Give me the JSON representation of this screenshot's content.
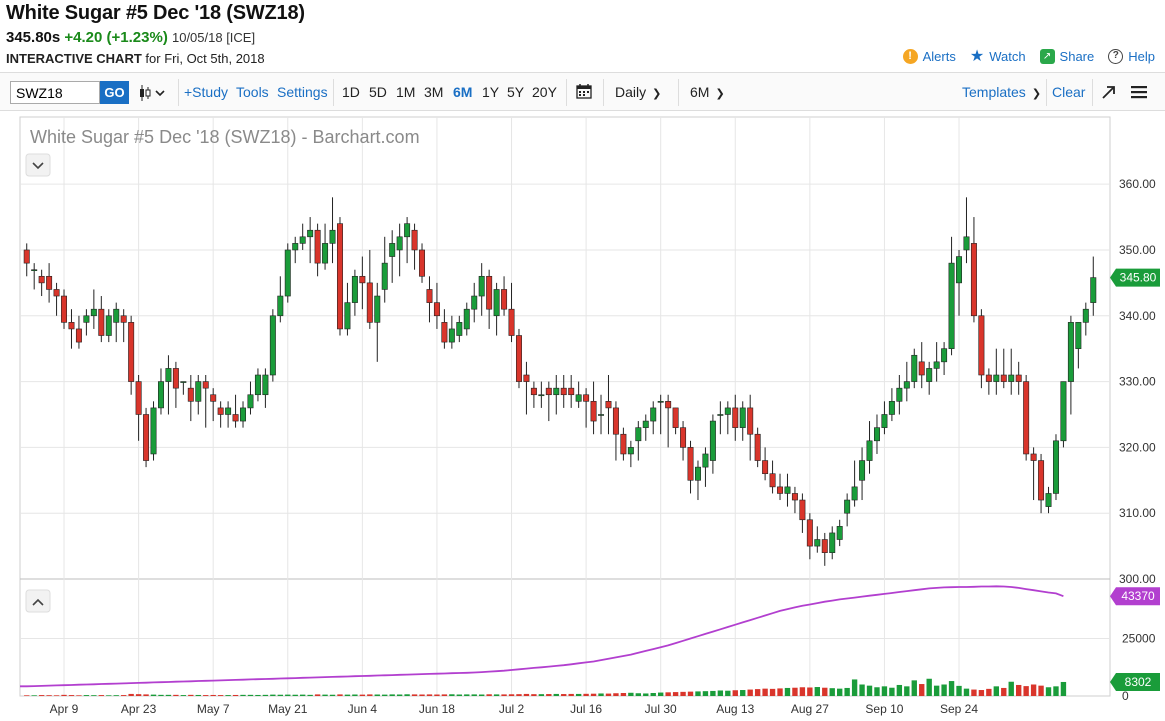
{
  "header": {
    "title": "White Sugar #5 Dec '18 (SWZ18)",
    "last_price": "345.80s",
    "change": "+4.20 (+1.23%)",
    "date_exchange": "10/05/18 [ICE]",
    "subtitle_bold": "INTERACTIVE CHART",
    "subtitle_rest": "for Fri, Oct 5th, 2018"
  },
  "actions": {
    "alerts": "Alerts",
    "watch": "Watch",
    "share": "Share",
    "help": "Help",
    "icons": [
      "exclamation-icon",
      "star-icon",
      "share-icon",
      "question-icon"
    ]
  },
  "toolbar": {
    "symbol_value": "SWZ18",
    "go_label": "GO",
    "study_label": "+Study",
    "tools_label": "Tools",
    "settings_label": "Settings",
    "periods": [
      "1D",
      "5D",
      "1M",
      "3M",
      "6M",
      "1Y",
      "5Y",
      "20Y"
    ],
    "active_period": "6M",
    "interval": "Daily",
    "range": "6M",
    "templates_label": "Templates",
    "clear_label": "Clear"
  },
  "colors": {
    "up": "#1a9c3a",
    "down": "#d9352b",
    "volume_line": "#b23fcf",
    "accent": "#1a6fc4",
    "price_badge": "#1a9c3a"
  },
  "chart_data": {
    "type": "candlestick",
    "title": "White Sugar #5 Dec '18 (SWZ18) - Barchart.com",
    "price_ylim": [
      300,
      362
    ],
    "price_ticks": [
      "360.00",
      "350.00",
      "340.00",
      "330.00",
      "320.00",
      "310.00",
      "300.00"
    ],
    "last_price_label": "345.80",
    "volume_ticks": [
      "25000",
      "0"
    ],
    "open_interest_label": "43370",
    "volume_label": "8302",
    "x_labels": [
      "Apr 9",
      "Apr 23",
      "May 7",
      "May 21",
      "Jun 4",
      "Jun 18",
      "Jul 2",
      "Jul 16",
      "Jul 30",
      "Aug 13",
      "Aug 27",
      "Sep 10",
      "Sep 24"
    ],
    "candles": [
      [
        350,
        351,
        346,
        348
      ],
      [
        347,
        348,
        344,
        347
      ],
      [
        346,
        347,
        343,
        345
      ],
      [
        346,
        348,
        342,
        344
      ],
      [
        344,
        345,
        340,
        343
      ],
      [
        343,
        344,
        338,
        339
      ],
      [
        339,
        341,
        335,
        338
      ],
      [
        338,
        340,
        335,
        336
      ],
      [
        339,
        341,
        337,
        340
      ],
      [
        340,
        344,
        338,
        341
      ],
      [
        341,
        343,
        336,
        337
      ],
      [
        337,
        341,
        336,
        340
      ],
      [
        339,
        342,
        336,
        341
      ],
      [
        340,
        341,
        336,
        339
      ],
      [
        339,
        340,
        328,
        330
      ],
      [
        330,
        331,
        321,
        325
      ],
      [
        325,
        326,
        317,
        318
      ],
      [
        319,
        327,
        318,
        326
      ],
      [
        326,
        332,
        325,
        330
      ],
      [
        330,
        334,
        325,
        332
      ],
      [
        332,
        333,
        326,
        329
      ],
      [
        330,
        330,
        328,
        330
      ],
      [
        329,
        331,
        324,
        327
      ],
      [
        327,
        331,
        325,
        330
      ],
      [
        330,
        331,
        323,
        329
      ],
      [
        328,
        329,
        324,
        327
      ],
      [
        326,
        327,
        323,
        325
      ],
      [
        325,
        327,
        323,
        326
      ],
      [
        325,
        328,
        323,
        324
      ],
      [
        324,
        327,
        323,
        326
      ],
      [
        326,
        330,
        325,
        328
      ],
      [
        328,
        332,
        327,
        331
      ],
      [
        328,
        332,
        326,
        331
      ],
      [
        331,
        341,
        330,
        340
      ],
      [
        340,
        346,
        339,
        343
      ],
      [
        343,
        351,
        342,
        350
      ],
      [
        350,
        352,
        348,
        351
      ],
      [
        351,
        354,
        350,
        352
      ],
      [
        352,
        355,
        348,
        353
      ],
      [
        353,
        354,
        346,
        348
      ],
      [
        348,
        354,
        347,
        351
      ],
      [
        351,
        358,
        348,
        353
      ],
      [
        354,
        355,
        337,
        338
      ],
      [
        338,
        345,
        337,
        342
      ],
      [
        342,
        347,
        340,
        346
      ],
      [
        346,
        349,
        341,
        345
      ],
      [
        345,
        350,
        338,
        339
      ],
      [
        339,
        345,
        333,
        343
      ],
      [
        344,
        352,
        342,
        348
      ],
      [
        349,
        353,
        345,
        351
      ],
      [
        350,
        354,
        346,
        352
      ],
      [
        352,
        355,
        348,
        354
      ],
      [
        353,
        354,
        347,
        350
      ],
      [
        350,
        351,
        345,
        346
      ],
      [
        344,
        346,
        339,
        342
      ],
      [
        342,
        345,
        338,
        340
      ],
      [
        339,
        341,
        335,
        336
      ],
      [
        336,
        340,
        335,
        338
      ],
      [
        337,
        340,
        336,
        339
      ],
      [
        338,
        342,
        337,
        341
      ],
      [
        341,
        345,
        339,
        343
      ],
      [
        343,
        348,
        340,
        346
      ],
      [
        346,
        347,
        338,
        341
      ],
      [
        340,
        345,
        337,
        344
      ],
      [
        344,
        346,
        340,
        341
      ],
      [
        341,
        345,
        336,
        337
      ],
      [
        337,
        338,
        329,
        330
      ],
      [
        331,
        333,
        325,
        330
      ],
      [
        329,
        330,
        326,
        328
      ],
      [
        328,
        330,
        326,
        328
      ],
      [
        329,
        330,
        324,
        328
      ],
      [
        328,
        331,
        325,
        329
      ],
      [
        329,
        331,
        326,
        328
      ],
      [
        329,
        331,
        326,
        328
      ],
      [
        327,
        330,
        326,
        328
      ],
      [
        328,
        329,
        323,
        327
      ],
      [
        327,
        330,
        322,
        324
      ],
      [
        325,
        328,
        322,
        325
      ],
      [
        327,
        331,
        322,
        326
      ],
      [
        326,
        327,
        318,
        322
      ],
      [
        322,
        323,
        318,
        319
      ],
      [
        319,
        321,
        317,
        320
      ],
      [
        321,
        324,
        318,
        323
      ],
      [
        323,
        325,
        321,
        324
      ],
      [
        324,
        327,
        322,
        326
      ],
      [
        327,
        328,
        322,
        327
      ],
      [
        327,
        328,
        320,
        326
      ],
      [
        326,
        326,
        322,
        323
      ],
      [
        323,
        324,
        318,
        320
      ],
      [
        320,
        321,
        313,
        315
      ],
      [
        315,
        318,
        312,
        317
      ],
      [
        317,
        320,
        314,
        319
      ],
      [
        318,
        325,
        316,
        324
      ],
      [
        325,
        327,
        322,
        325
      ],
      [
        325,
        327,
        322,
        326
      ],
      [
        326,
        328,
        321,
        323
      ],
      [
        323,
        327,
        321,
        326
      ],
      [
        326,
        328,
        318,
        322
      ],
      [
        322,
        323,
        317,
        318
      ],
      [
        318,
        320,
        315,
        316
      ],
      [
        316,
        318,
        313,
        314
      ],
      [
        314,
        316,
        312,
        313
      ],
      [
        313,
        316,
        311,
        314
      ],
      [
        313,
        314,
        310,
        312
      ],
      [
        312,
        313,
        307,
        309
      ],
      [
        309,
        310,
        303,
        305
      ],
      [
        305,
        308,
        304,
        306
      ],
      [
        306,
        307,
        302,
        304
      ],
      [
        304,
        308,
        303,
        307
      ],
      [
        306,
        309,
        305,
        308
      ],
      [
        310,
        313,
        308,
        312
      ],
      [
        312,
        318,
        311,
        314
      ],
      [
        315,
        320,
        312,
        318
      ],
      [
        318,
        324,
        316,
        321
      ],
      [
        321,
        325,
        319,
        323
      ],
      [
        323,
        327,
        322,
        325
      ],
      [
        325,
        329,
        324,
        327
      ],
      [
        327,
        331,
        325,
        329
      ],
      [
        329,
        333,
        327,
        330
      ],
      [
        330,
        335,
        329,
        334
      ],
      [
        333,
        336,
        329,
        331
      ],
      [
        330,
        333,
        328,
        332
      ],
      [
        332,
        336,
        330,
        333
      ],
      [
        333,
        336,
        331,
        335
      ],
      [
        335,
        352,
        334,
        348
      ],
      [
        345,
        350,
        340,
        349
      ],
      [
        350,
        358,
        348,
        352
      ],
      [
        351,
        355,
        339,
        340
      ],
      [
        340,
        341,
        329,
        331
      ],
      [
        331,
        332,
        328,
        330
      ],
      [
        330,
        335,
        328,
        331
      ],
      [
        331,
        335,
        329,
        330
      ],
      [
        330,
        335,
        328,
        331
      ],
      [
        331,
        333,
        328,
        330
      ],
      [
        330,
        331,
        318,
        319
      ],
      [
        319,
        320,
        312,
        318
      ],
      [
        318,
        319,
        310,
        312
      ],
      [
        311,
        314,
        310,
        313
      ],
      [
        313,
        322,
        312,
        321
      ],
      [
        321,
        330,
        320,
        330
      ],
      [
        330,
        340,
        325,
        339
      ],
      [
        335,
        339,
        332,
        339
      ],
      [
        339,
        342,
        337,
        341
      ],
      [
        342,
        349,
        340,
        345.8
      ]
    ],
    "volume": [
      300,
      300,
      400,
      350,
      300,
      500,
      400,
      300,
      400,
      350,
      400,
      300,
      350,
      400,
      900,
      800,
      700,
      600,
      500,
      500,
      500,
      400,
      500,
      450,
      400,
      450,
      400,
      400,
      450,
      500,
      500,
      450,
      500,
      600,
      550,
      600,
      550,
      600,
      500,
      700,
      600,
      550,
      700,
      600,
      650,
      600,
      700,
      650,
      600,
      700,
      650,
      750,
      700,
      650,
      700,
      650,
      700,
      750,
      650,
      700,
      700,
      650,
      750,
      700,
      700,
      750,
      800,
      900,
      800,
      800,
      850,
      900,
      850,
      900,
      900,
      950,
      1000,
      1100,
      1050,
      1200,
      1300,
      1400,
      1200,
      1100,
      1300,
      1500,
      1600,
      1700,
      1800,
      1900,
      2000,
      2100,
      2200,
      2400,
      2300,
      2500,
      2600,
      2800,
      3000,
      3200,
      3100,
      3300,
      3500,
      3600,
      3800,
      3700,
      3900,
      3600,
      3400,
      3200,
      3500,
      7200,
      5000,
      4500,
      3800,
      4200,
      3600,
      4800,
      4200,
      6800,
      5200,
      7500,
      4500,
      5000,
      6500,
      4400,
      3200,
      2800,
      2600,
      3100,
      4200,
      3500,
      6200,
      4800,
      4300,
      5000,
      4500,
      3800,
      4200,
      6100
    ],
    "open_interest": [
      4200,
      4300,
      4400,
      4500,
      4600,
      4700,
      4800,
      4900,
      5000,
      5100,
      5200,
      5300,
      5400,
      5500,
      5600,
      5700,
      5800,
      5900,
      6000,
      6100,
      6200,
      6300,
      6400,
      6500,
      6600,
      6700,
      6800,
      6900,
      7000,
      7100,
      7200,
      7300,
      7400,
      7500,
      7600,
      7700,
      7800,
      7900,
      8000,
      8100,
      8200,
      8300,
      8400,
      8500,
      8600,
      8700,
      8800,
      8900,
      9000,
      9100,
      9200,
      9300,
      9400,
      9500,
      9600,
      9700,
      9800,
      9900,
      10000,
      10100,
      10200,
      10400,
      10600,
      10800,
      11000,
      11300,
      11600,
      11900,
      12200,
      12500,
      12800,
      13100,
      13400,
      13800,
      14200,
      14600,
      15000,
      15600,
      16200,
      16800,
      17400,
      18000,
      18800,
      19600,
      20400,
      21200,
      22000,
      23000,
      24000,
      25000,
      26000,
      27000,
      28000,
      29000,
      30000,
      31000,
      32000,
      33000,
      34000,
      35000,
      36000,
      37000,
      37800,
      38500,
      39200,
      39800,
      40400,
      41000,
      41500,
      42000,
      42400,
      42800,
      43200,
      43600,
      44000,
      44400,
      44800,
      45200,
      45600,
      46000,
      46400,
      46800,
      47000,
      47200,
      47300,
      47400,
      47400,
      47500,
      47600,
      47600,
      47700,
      47600,
      47400,
      47000,
      46500,
      46000,
      45500,
      45000,
      44600,
      43370
    ]
  }
}
